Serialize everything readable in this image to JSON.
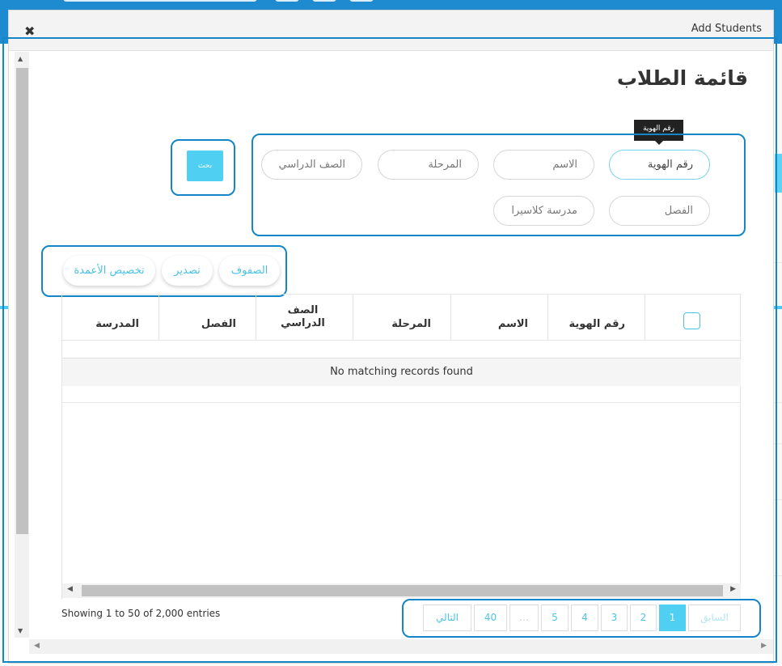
{
  "modal": {
    "title": "Add Students",
    "close_glyph": "✖",
    "heading": "قائمة الطلاب"
  },
  "tooltip": "رقم الهوية",
  "filters": {
    "id_number": "رقم الهوية",
    "name": "الاسم",
    "stage": "المرحلة",
    "grade": "الصف الدراسي",
    "class": "الفصل",
    "school": "مدرسة كلاسيرا"
  },
  "search_button": "بحث",
  "toolbar": {
    "rows": "الصفوف",
    "export": "تصدير",
    "customize_columns": "تخصيص الأعمدة"
  },
  "table": {
    "columns": [
      "رقم الهوية",
      "الاسم",
      "المرحلة",
      "الصف الدراسي",
      "الفصل",
      "المدرسة"
    ],
    "grade_line1": "الصف",
    "grade_line2": "الدراسي",
    "empty_message": "No matching records found"
  },
  "pagination": {
    "info": "Showing 1 to 50 of 2,000 entries",
    "previous": "السابق",
    "next": "التالي",
    "pages": [
      "1",
      "2",
      "3",
      "4",
      "5",
      "…",
      "40"
    ],
    "active_page": "1"
  },
  "scroll_glyphs": {
    "up": "▲",
    "down": "▼",
    "left": "◀",
    "right": "▶"
  },
  "colors": {
    "accent": "#4fd0f2",
    "highlight_border": "#1485c6",
    "topbar": "#1e8ad0"
  }
}
